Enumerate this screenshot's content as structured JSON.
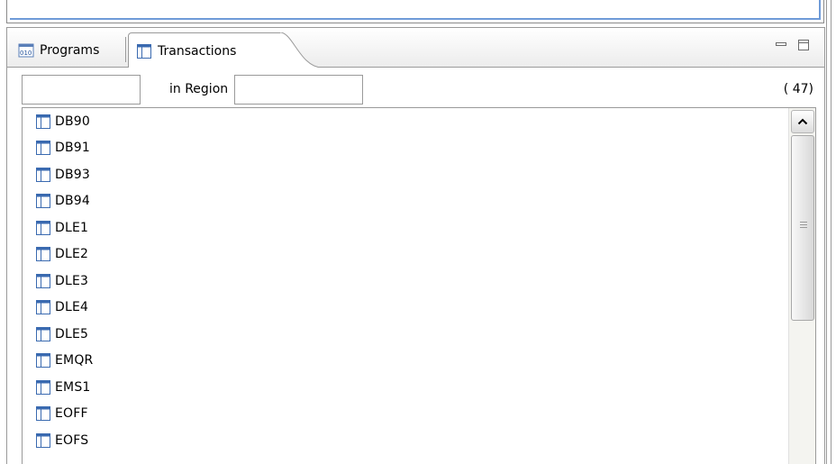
{
  "tabs": [
    {
      "label": "Programs",
      "icon": "binary-program-icon",
      "active": false
    },
    {
      "label": "Transactions",
      "icon": "transaction-table-icon",
      "active": true
    }
  ],
  "window_controls": {
    "minimize_icon": "minimize-icon",
    "maximize_icon": "maximize-icon"
  },
  "filter": {
    "name_value": "",
    "region_label": "in Region",
    "region_value": "",
    "count": "( 47)"
  },
  "transactions": [
    "DB90",
    "DB91",
    "DB93",
    "DB94",
    "DLE1",
    "DLE2",
    "DLE3",
    "DLE4",
    "DLE5",
    "EMQR",
    "EMS1",
    "EOFF",
    "EOFS"
  ],
  "colors": {
    "accent": "#6f9bd8",
    "border": "#9a9a9a",
    "icon_blue": "#3a6ab0"
  }
}
